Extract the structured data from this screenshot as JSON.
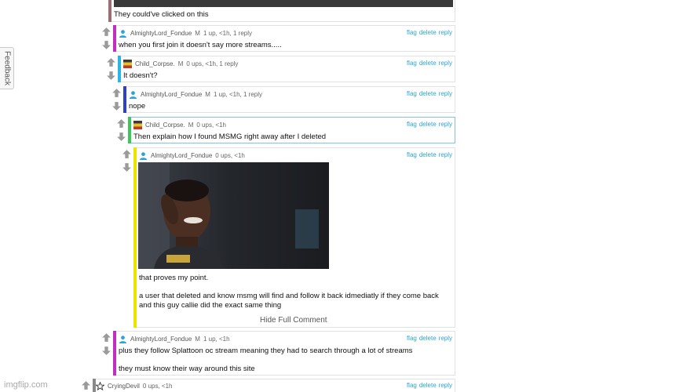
{
  "feedback_label": "Feedback",
  "watermark": "imgflip.com",
  "top_comment": {
    "text": "They could've clicked on this"
  },
  "comments": [
    {
      "user": "AlmightyLord_Fondue",
      "badge": "M",
      "meta": "1 up, <1h, 1 reply",
      "text": "when you first join it doesn't say more streams.....",
      "bar_color": "#c02fbf",
      "avatar": "person"
    },
    {
      "user": "Child_Corpse.",
      "badge": "M",
      "meta": "0 ups, <1h, 1 reply",
      "text": "It doesn't?",
      "bar_color": "#29b6e6",
      "avatar": "flag"
    },
    {
      "user": "AlmightyLord_Fondue",
      "badge": "M",
      "meta": "1 up, <1h, 1 reply",
      "text": "nope",
      "bar_color": "#3040c8",
      "avatar": "person"
    },
    {
      "user": "Child_Corpse.",
      "badge": "M",
      "meta": "0 ups, <1h",
      "text": "Then explain how I found MSMG right away after I deleted",
      "bar_color": "#3ac85a",
      "avatar": "flag"
    },
    {
      "user": "AlmightyLord_Fondue",
      "badge": "",
      "meta": "0 ups, <1h",
      "text": "that proves my point.\n\na user that deleted and know msmg will find and follow it back idmediatly if they come back\nand this guy callie did the exact same thing",
      "bar_color": "#e6e600",
      "avatar": "person",
      "hide_full": "Hide Full Comment"
    },
    {
      "user": "AlmightyLord_Fondue",
      "badge": "M",
      "meta": "1 up, <1h",
      "text": "plus they follow Splattoon oc stream meaning they had to search through a lot of streams\n\nthey must know their way around this site",
      "bar_color": "#c02fbf",
      "avatar": "person"
    },
    {
      "user": "CryingDevil",
      "badge": "",
      "meta": "0 ups, <1h",
      "text": "",
      "bar_color": "#8a8a8a",
      "avatar": "star"
    }
  ],
  "actions": {
    "flag": "flag",
    "delete": "delete",
    "reply": "reply"
  },
  "colors": {
    "link": "#2aa4d8",
    "person_icon": "#2aa4d8"
  }
}
